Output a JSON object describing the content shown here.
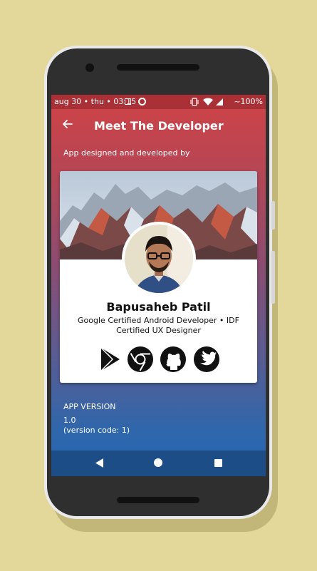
{
  "statusbar": {
    "left": "aug 30 • thu • 03:15",
    "right": "~100%"
  },
  "appbar": {
    "title": "Meet The Developer",
    "back_icon": "arrow-back-icon"
  },
  "subtitle": "App designed and developed by",
  "developer": {
    "name": "Bapusaheb Patil",
    "role": "Google Certified Android Developer • IDF Certified UX Designer",
    "links": [
      "google-play-icon",
      "chrome-icon",
      "github-icon",
      "twitter-icon"
    ]
  },
  "app_version": {
    "label": "APP VERSION",
    "value": "1.0",
    "code": "(version code: 1)"
  },
  "navbar": {
    "icons": [
      "nav-back-icon",
      "nav-home-icon",
      "nav-recents-icon"
    ]
  },
  "colors": {
    "gradient_top": "#cf4346",
    "gradient_bottom": "#2465b3",
    "background": "#e3d79a"
  }
}
